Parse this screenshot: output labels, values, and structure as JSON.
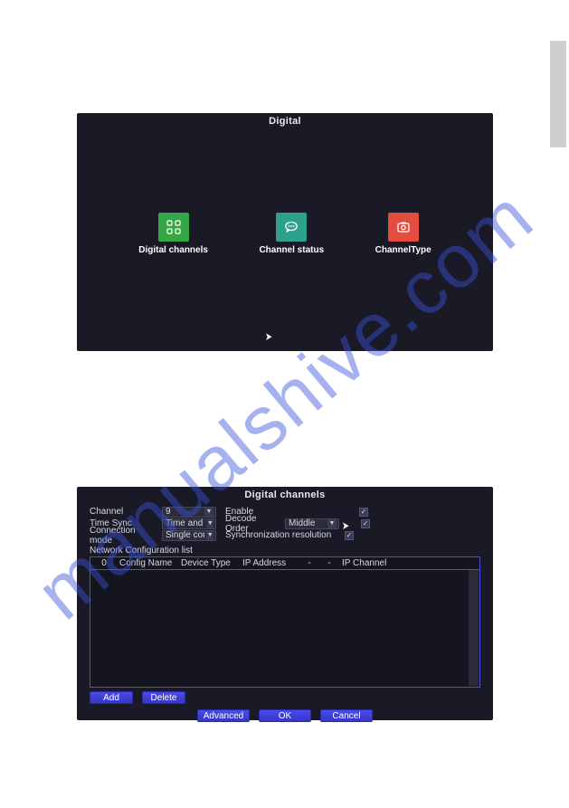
{
  "watermark": "manualshive.com",
  "panel1": {
    "title": "Digital",
    "tiles": {
      "digital_channels": "Digital channels",
      "channel_status": "Channel status",
      "channel_type": "ChannelType"
    }
  },
  "panel2": {
    "title": "Digital channels",
    "labels": {
      "channel": "Channel",
      "time_sync": "Time Sync",
      "connection_mode": "Connection mode",
      "enable": "Enable",
      "decode_order": "Decode Order",
      "sync_res": "Synchronization resolution",
      "network_config_list": "Network Configuration list"
    },
    "values": {
      "channel": "9",
      "time_sync": "Time and Tim",
      "connection_mode": "Single conne",
      "decode_order": "Middle"
    },
    "checks": {
      "enable": "✓",
      "decode_order": "✓",
      "sync_res": "✓"
    },
    "table": {
      "h0": "0",
      "h1": "Config Name",
      "h2": "Device Type",
      "h3": "IP Address",
      "h4": "-",
      "h5": "-",
      "h6": "IP Channel"
    },
    "buttons": {
      "add": "Add",
      "delete": "Delete",
      "advanced": "Advanced",
      "ok": "OK",
      "cancel": "Cancel"
    }
  }
}
